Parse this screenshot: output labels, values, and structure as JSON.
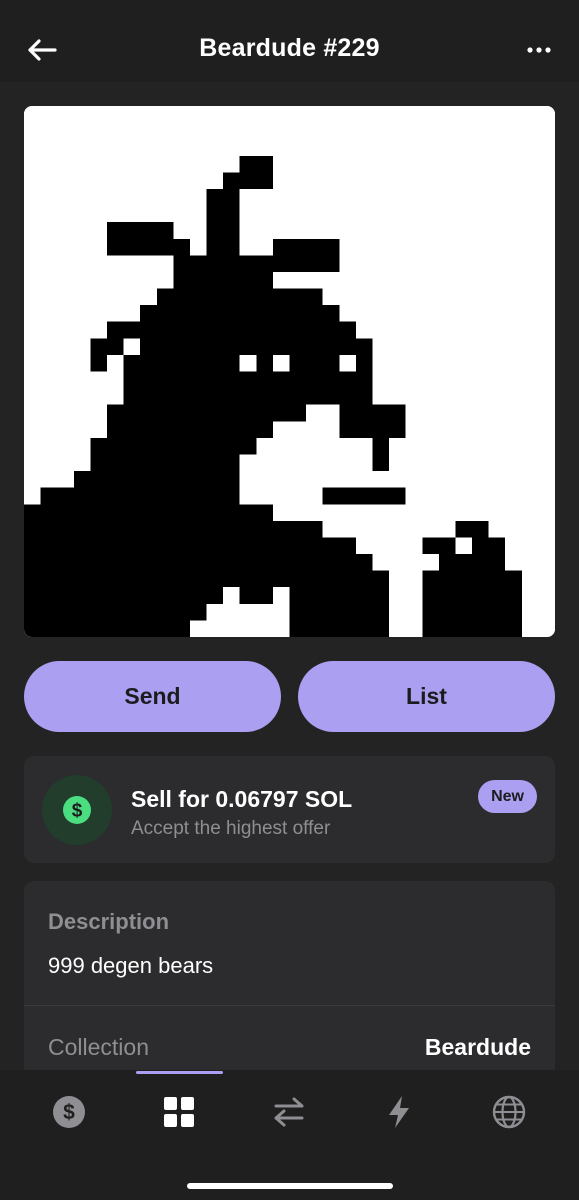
{
  "header": {
    "title": "Beardude #229",
    "back_icon": "arrow-left-icon",
    "more_icon": "ellipsis-icon"
  },
  "nft": {
    "image_icon": "beardude-pixel-art",
    "background": "#ffffff",
    "foreground": "#000000"
  },
  "actions": {
    "send_label": "Send",
    "list_label": "List"
  },
  "sell": {
    "title": "Sell for 0.06797 SOL",
    "subtitle": "Accept the highest offer",
    "badge": "New",
    "icon": "dollar-circle-icon",
    "icon_color": "#4ade80"
  },
  "details": {
    "description_label": "Description",
    "description_value": "999 degen bears",
    "collection_label": "Collection",
    "collection_value": "Beardude"
  },
  "tabs": [
    {
      "icon": "dollar-icon",
      "active": false
    },
    {
      "icon": "grid-icon",
      "active": true
    },
    {
      "icon": "swap-icon",
      "active": false
    },
    {
      "icon": "lightning-icon",
      "active": false
    },
    {
      "icon": "globe-icon",
      "active": false
    }
  ],
  "colors": {
    "accent": "#ab9ff2",
    "background": "#232324",
    "card": "#2c2c2e",
    "muted_text": "#8e8e93"
  }
}
